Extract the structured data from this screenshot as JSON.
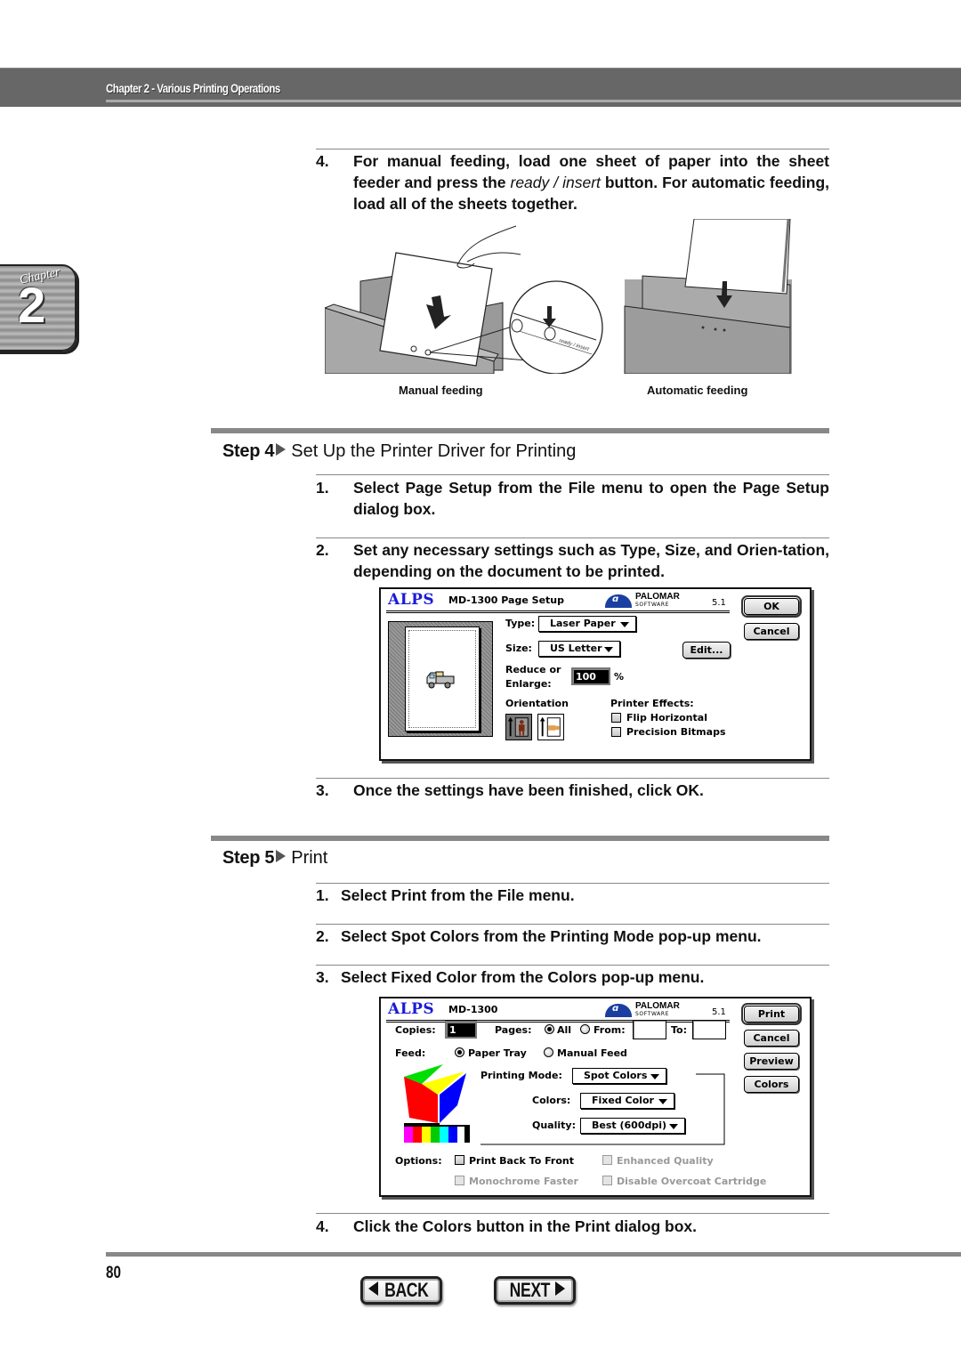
{
  "header": {
    "title": "Chapter 2 - Various Printing Operations"
  },
  "chapter_tab": {
    "word": "Chapter",
    "number": "2"
  },
  "intro_item": {
    "number": "4.",
    "text_before": "For manual feeding, load one sheet of paper into the sheet feeder and press the ",
    "italic": "ready / insert",
    "text_after": " button. For automatic feeding, load all of the sheets together."
  },
  "figures": {
    "manual": {
      "caption": "Manual feeding",
      "callout_label": "ready / insert"
    },
    "automatic": {
      "caption": "Automatic feeding"
    }
  },
  "step4": {
    "label": "Step 4",
    "title": "Set Up the Printer Driver for Printing",
    "items": [
      {
        "number": "1.",
        "text": "Select Page Setup from the File menu to open the Page Setup dialog box."
      },
      {
        "number": "2.",
        "text": "Set any necessary settings such as Type, Size, and Orien-tation, depending on the document to be printed."
      },
      {
        "number": "3.",
        "text": "Once the settings have been finished, click OK."
      }
    ]
  },
  "page_setup_dialog": {
    "brand": "ALPS",
    "title": "MD-1300 Page Setup",
    "vendor_line1": "PALOMAR",
    "vendor_line2": "SOFTWARE",
    "version": "5.1",
    "ok_label": "OK",
    "cancel_label": "Cancel",
    "type_label": "Type:",
    "type_value": "Laser Paper",
    "size_label": "Size:",
    "size_value": "US Letter",
    "edit_label": "Edit...",
    "reduce_label_1": "Reduce or",
    "reduce_label_2": "Enlarge:",
    "reduce_value": "100",
    "percent": "%",
    "orientation_label": "Orientation",
    "orientation_selected": "portrait",
    "effects_label": "Printer Effects:",
    "effects": [
      {
        "label": "Flip Horizontal",
        "checked": false
      },
      {
        "label": "Precision Bitmaps",
        "checked": false
      }
    ]
  },
  "step5": {
    "label": "Step 5",
    "title": "Print",
    "items": [
      {
        "number": "1.",
        "text": "Select Print from the File menu."
      },
      {
        "number": "2.",
        "text": "Select Spot Colors from the Printing Mode pop-up menu."
      },
      {
        "number": "3.",
        "text": "Select Fixed Color from the Colors pop-up menu."
      },
      {
        "number": "4.",
        "text": "Click the Colors button in the Print dialog box."
      }
    ]
  },
  "print_dialog": {
    "brand": "ALPS",
    "title": "MD-1300",
    "vendor_line1": "PALOMAR",
    "vendor_line2": "SOFTWARE",
    "version": "5.1",
    "print_label": "Print",
    "cancel_label": "Cancel",
    "preview_label": "Preview",
    "colors_label": "Colors",
    "copies_label": "Copies:",
    "copies_value": "1",
    "pages_label": "Pages:",
    "pages_all": "All",
    "pages_from": "From:",
    "pages_to": "To:",
    "from_value": "",
    "to_value": "",
    "pages_selected": "All",
    "feed_label": "Feed:",
    "feed_paper_tray": "Paper Tray",
    "feed_manual": "Manual Feed",
    "feed_selected": "Paper Tray",
    "printing_mode_label": "Printing Mode:",
    "printing_mode_value": "Spot Colors",
    "colors_popup_label": "Colors:",
    "colors_popup_value": "Fixed Color",
    "quality_label": "Quality:",
    "quality_value": "Best (600dpi)",
    "options_label": "Options:",
    "options": [
      {
        "label": "Print Back To Front",
        "checked": false,
        "enabled": true
      },
      {
        "label": "Enhanced Quality",
        "checked": false,
        "enabled": false
      },
      {
        "label": "Monochrome Faster",
        "checked": false,
        "enabled": false
      },
      {
        "label": "Disable Overcoat Cartridge",
        "checked": false,
        "enabled": false
      }
    ],
    "swatch_colors": [
      "#ff00ff",
      "#ff0000",
      "#ffff00",
      "#00cc00",
      "#00ffff",
      "#0000ff",
      "#ffffff",
      "#000000"
    ]
  },
  "footer": {
    "page_number": "80",
    "back_label": "BACK",
    "next_label": "NEXT"
  }
}
